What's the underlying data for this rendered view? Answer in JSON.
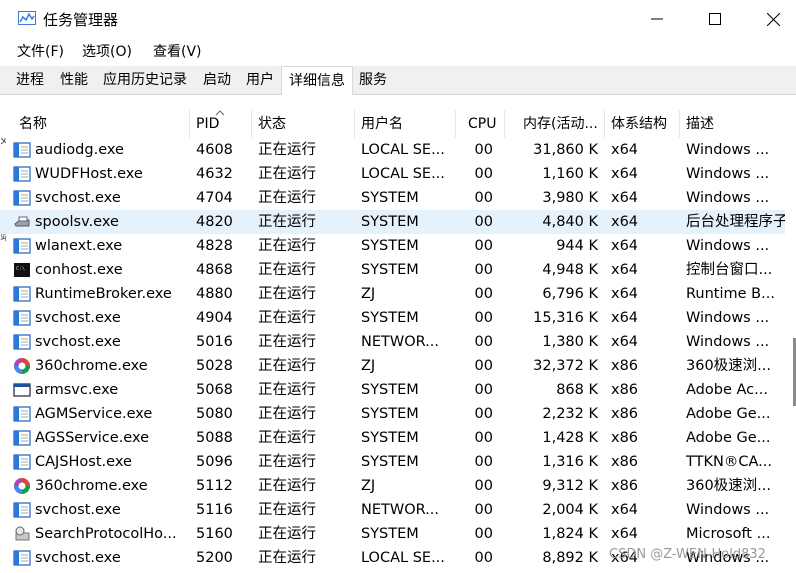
{
  "window": {
    "title": "任务管理器"
  },
  "menu": [
    "文件(F)",
    "选项(O)",
    "查看(V)"
  ],
  "tabs": [
    {
      "label": "进程",
      "active": false
    },
    {
      "label": "性能",
      "active": false
    },
    {
      "label": "应用历史记录",
      "active": false
    },
    {
      "label": "启动",
      "active": false
    },
    {
      "label": "用户",
      "active": false
    },
    {
      "label": "详细信息",
      "active": true
    },
    {
      "label": "服务",
      "active": false
    }
  ],
  "columns": [
    "名称",
    "PID",
    "状态",
    "用户名",
    "CPU",
    "内存(活动...",
    "体系结构",
    "描述"
  ],
  "rows": [
    {
      "icon": "app-window-icon",
      "name": "audiodg.exe",
      "pid": "4608",
      "status": "正在运行",
      "user": "LOCAL SE...",
      "cpu": "00",
      "mem": "31,860 K",
      "arch": "x64",
      "desc": "Windows ..."
    },
    {
      "icon": "app-window-icon",
      "name": "WUDFHost.exe",
      "pid": "4632",
      "status": "正在运行",
      "user": "LOCAL SE...",
      "cpu": "00",
      "mem": "1,160 K",
      "arch": "x64",
      "desc": "Windows ..."
    },
    {
      "icon": "app-window-icon",
      "name": "svchost.exe",
      "pid": "4704",
      "status": "正在运行",
      "user": "SYSTEM",
      "cpu": "00",
      "mem": "3,980 K",
      "arch": "x64",
      "desc": "Windows ..."
    },
    {
      "icon": "printer-icon",
      "name": "spoolsv.exe",
      "pid": "4820",
      "status": "正在运行",
      "user": "SYSTEM",
      "cpu": "00",
      "mem": "4,840 K",
      "arch": "x64",
      "desc": "后台处理程序子系",
      "highlight": true
    },
    {
      "icon": "app-window-icon",
      "name": "wlanext.exe",
      "pid": "4828",
      "status": "正在运行",
      "user": "SYSTEM",
      "cpu": "00",
      "mem": "944 K",
      "arch": "x64",
      "desc": "Windows ..."
    },
    {
      "icon": "console-icon",
      "name": "conhost.exe",
      "pid": "4868",
      "status": "正在运行",
      "user": "SYSTEM",
      "cpu": "00",
      "mem": "4,948 K",
      "arch": "x64",
      "desc": "控制台窗口..."
    },
    {
      "icon": "app-window-icon",
      "name": "RuntimeBroker.exe",
      "pid": "4880",
      "status": "正在运行",
      "user": "ZJ",
      "cpu": "00",
      "mem": "6,796 K",
      "arch": "x64",
      "desc": "Runtime B..."
    },
    {
      "icon": "app-window-icon",
      "name": "svchost.exe",
      "pid": "4904",
      "status": "正在运行",
      "user": "SYSTEM",
      "cpu": "00",
      "mem": "15,316 K",
      "arch": "x64",
      "desc": "Windows ..."
    },
    {
      "icon": "app-window-icon",
      "name": "svchost.exe",
      "pid": "5016",
      "status": "正在运行",
      "user": "NETWOR...",
      "cpu": "00",
      "mem": "1,380 K",
      "arch": "x64",
      "desc": "Windows ..."
    },
    {
      "icon": "browser-360-icon",
      "name": "360chrome.exe",
      "pid": "5028",
      "status": "正在运行",
      "user": "ZJ",
      "cpu": "00",
      "mem": "32,372 K",
      "arch": "x86",
      "desc": "360极速浏..."
    },
    {
      "icon": "blank-window-icon",
      "name": "armsvc.exe",
      "pid": "5068",
      "status": "正在运行",
      "user": "SYSTEM",
      "cpu": "00",
      "mem": "868 K",
      "arch": "x86",
      "desc": "Adobe Ac..."
    },
    {
      "icon": "app-window-icon",
      "name": "AGMService.exe",
      "pid": "5080",
      "status": "正在运行",
      "user": "SYSTEM",
      "cpu": "00",
      "mem": "2,232 K",
      "arch": "x86",
      "desc": "Adobe Ge..."
    },
    {
      "icon": "app-window-icon",
      "name": "AGSService.exe",
      "pid": "5088",
      "status": "正在运行",
      "user": "SYSTEM",
      "cpu": "00",
      "mem": "1,428 K",
      "arch": "x86",
      "desc": "Adobe Ge..."
    },
    {
      "icon": "app-window-icon",
      "name": "CAJSHost.exe",
      "pid": "5096",
      "status": "正在运行",
      "user": "SYSTEM",
      "cpu": "00",
      "mem": "1,316 K",
      "arch": "x86",
      "desc": "TTKN®CA..."
    },
    {
      "icon": "browser-360-icon",
      "name": "360chrome.exe",
      "pid": "5112",
      "status": "正在运行",
      "user": "ZJ",
      "cpu": "00",
      "mem": "9,312 K",
      "arch": "x86",
      "desc": "360极速浏..."
    },
    {
      "icon": "app-window-icon",
      "name": "svchost.exe",
      "pid": "5116",
      "status": "正在运行",
      "user": "NETWOR...",
      "cpu": "00",
      "mem": "2,004 K",
      "arch": "x64",
      "desc": "Windows ..."
    },
    {
      "icon": "search-protocol-icon",
      "name": "SearchProtocolHo...",
      "pid": "5160",
      "status": "正在运行",
      "user": "SYSTEM",
      "cpu": "00",
      "mem": "1,824 K",
      "arch": "x64",
      "desc": "Microsoft ..."
    },
    {
      "icon": "app-window-icon",
      "name": "svchost.exe",
      "pid": "5200",
      "status": "正在运行",
      "user": "LOCAL SE...",
      "cpu": "00",
      "mem": "8,892 K",
      "arch": "x64",
      "desc": "Windows ..."
    }
  ],
  "watermark": "CSDN @Z-WEN-Hold832"
}
